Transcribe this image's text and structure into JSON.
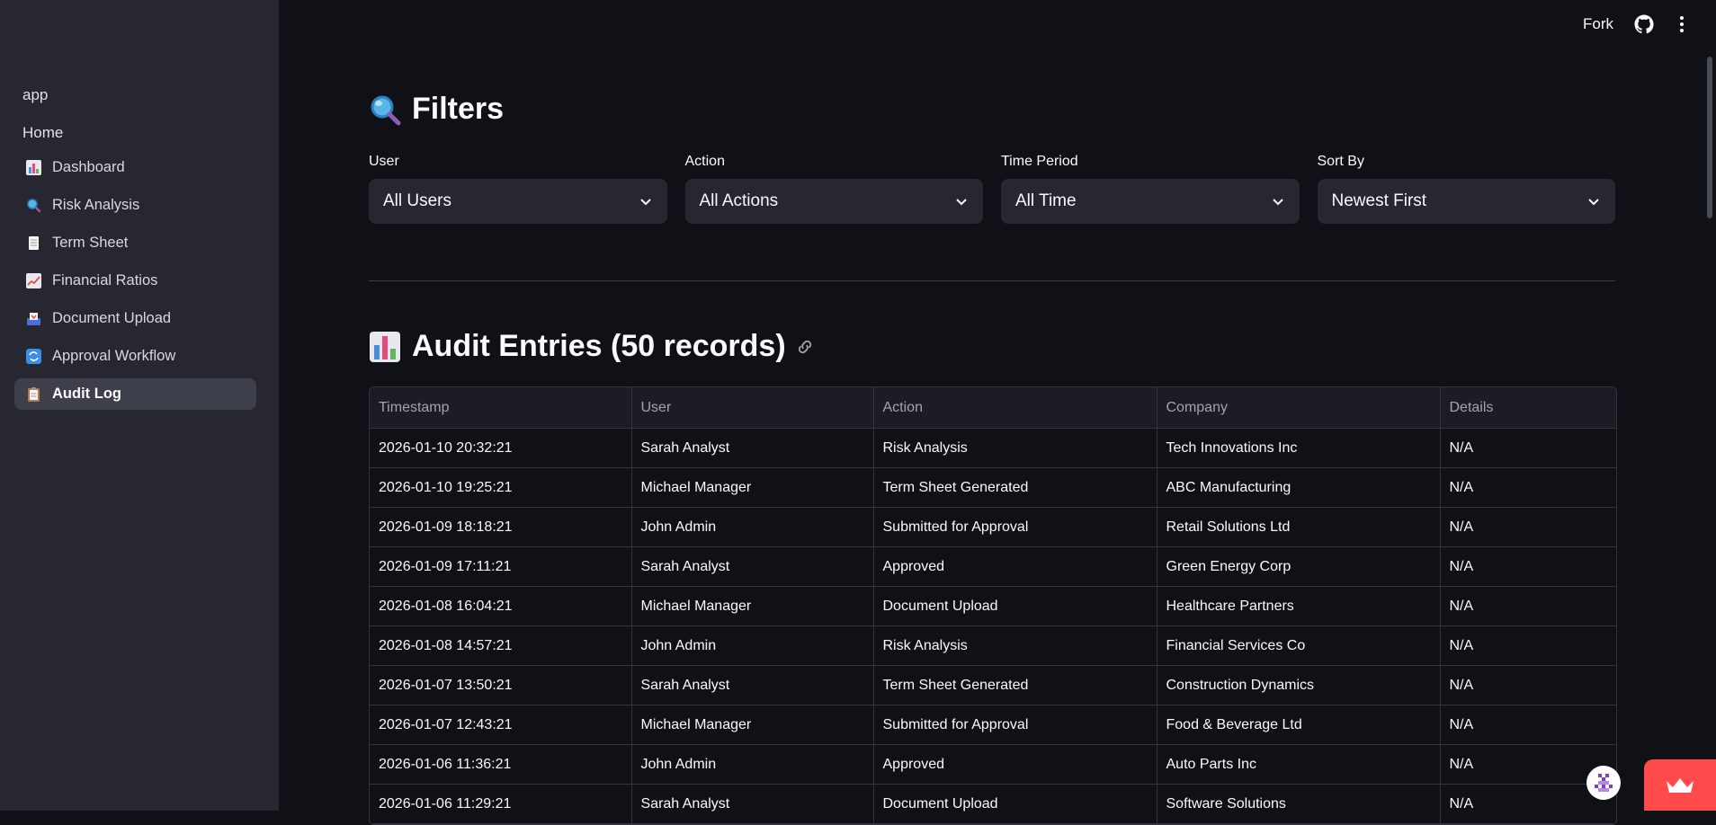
{
  "sidebar": {
    "app_label": "app",
    "home_label": "Home",
    "items": [
      {
        "label": "Dashboard",
        "icon": "bar-chart-icon",
        "active": false
      },
      {
        "label": "Risk Analysis",
        "icon": "magnifier-icon",
        "active": false
      },
      {
        "label": "Term Sheet",
        "icon": "page-icon",
        "active": false
      },
      {
        "label": "Financial Ratios",
        "icon": "line-chart-icon",
        "active": false
      },
      {
        "label": "Document Upload",
        "icon": "inbox-tray-icon",
        "active": false
      },
      {
        "label": "Approval Workflow",
        "icon": "arrows-cycle-icon",
        "active": false
      },
      {
        "label": "Audit Log",
        "icon": "clipboard-icon",
        "active": true
      }
    ]
  },
  "header": {
    "fork_label": "Fork",
    "github_icon": "github-icon",
    "menu_icon": "kebab-menu-icon"
  },
  "filters": {
    "title": "Filters",
    "title_icon": "magnifier-icon",
    "fields": [
      {
        "label": "User",
        "value": "All Users"
      },
      {
        "label": "Action",
        "value": "All Actions"
      },
      {
        "label": "Time Period",
        "value": "All Time"
      },
      {
        "label": "Sort By",
        "value": "Newest First"
      }
    ]
  },
  "audit": {
    "title": "Audit Entries (50 records)",
    "title_icon": "bar-chart-icon",
    "columns": [
      "Timestamp",
      "User",
      "Action",
      "Company",
      "Details"
    ],
    "rows": [
      [
        "2026-01-10 20:32:21",
        "Sarah Analyst",
        "Risk Analysis",
        "Tech Innovations Inc",
        "N/A"
      ],
      [
        "2026-01-10 19:25:21",
        "Michael Manager",
        "Term Sheet Generated",
        "ABC Manufacturing",
        "N/A"
      ],
      [
        "2026-01-09 18:18:21",
        "John Admin",
        "Submitted for Approval",
        "Retail Solutions Ltd",
        "N/A"
      ],
      [
        "2026-01-09 17:11:21",
        "Sarah Analyst",
        "Approved",
        "Green Energy Corp",
        "N/A"
      ],
      [
        "2026-01-08 16:04:21",
        "Michael Manager",
        "Document Upload",
        "Healthcare Partners",
        "N/A"
      ],
      [
        "2026-01-08 14:57:21",
        "John Admin",
        "Risk Analysis",
        "Financial Services Co",
        "N/A"
      ],
      [
        "2026-01-07 13:50:21",
        "Sarah Analyst",
        "Term Sheet Generated",
        "Construction Dynamics",
        "N/A"
      ],
      [
        "2026-01-07 12:43:21",
        "Michael Manager",
        "Submitted for Approval",
        "Food & Beverage Ltd",
        "N/A"
      ],
      [
        "2026-01-06 11:36:21",
        "John Admin",
        "Approved",
        "Auto Parts Inc",
        "N/A"
      ],
      [
        "2026-01-06 11:29:21",
        "Sarah Analyst",
        "Document Upload",
        "Software Solutions",
        "N/A"
      ]
    ]
  },
  "colors": {
    "background": "#0f1117",
    "sidebar": "#262730",
    "accent": "#ff4b4b"
  }
}
